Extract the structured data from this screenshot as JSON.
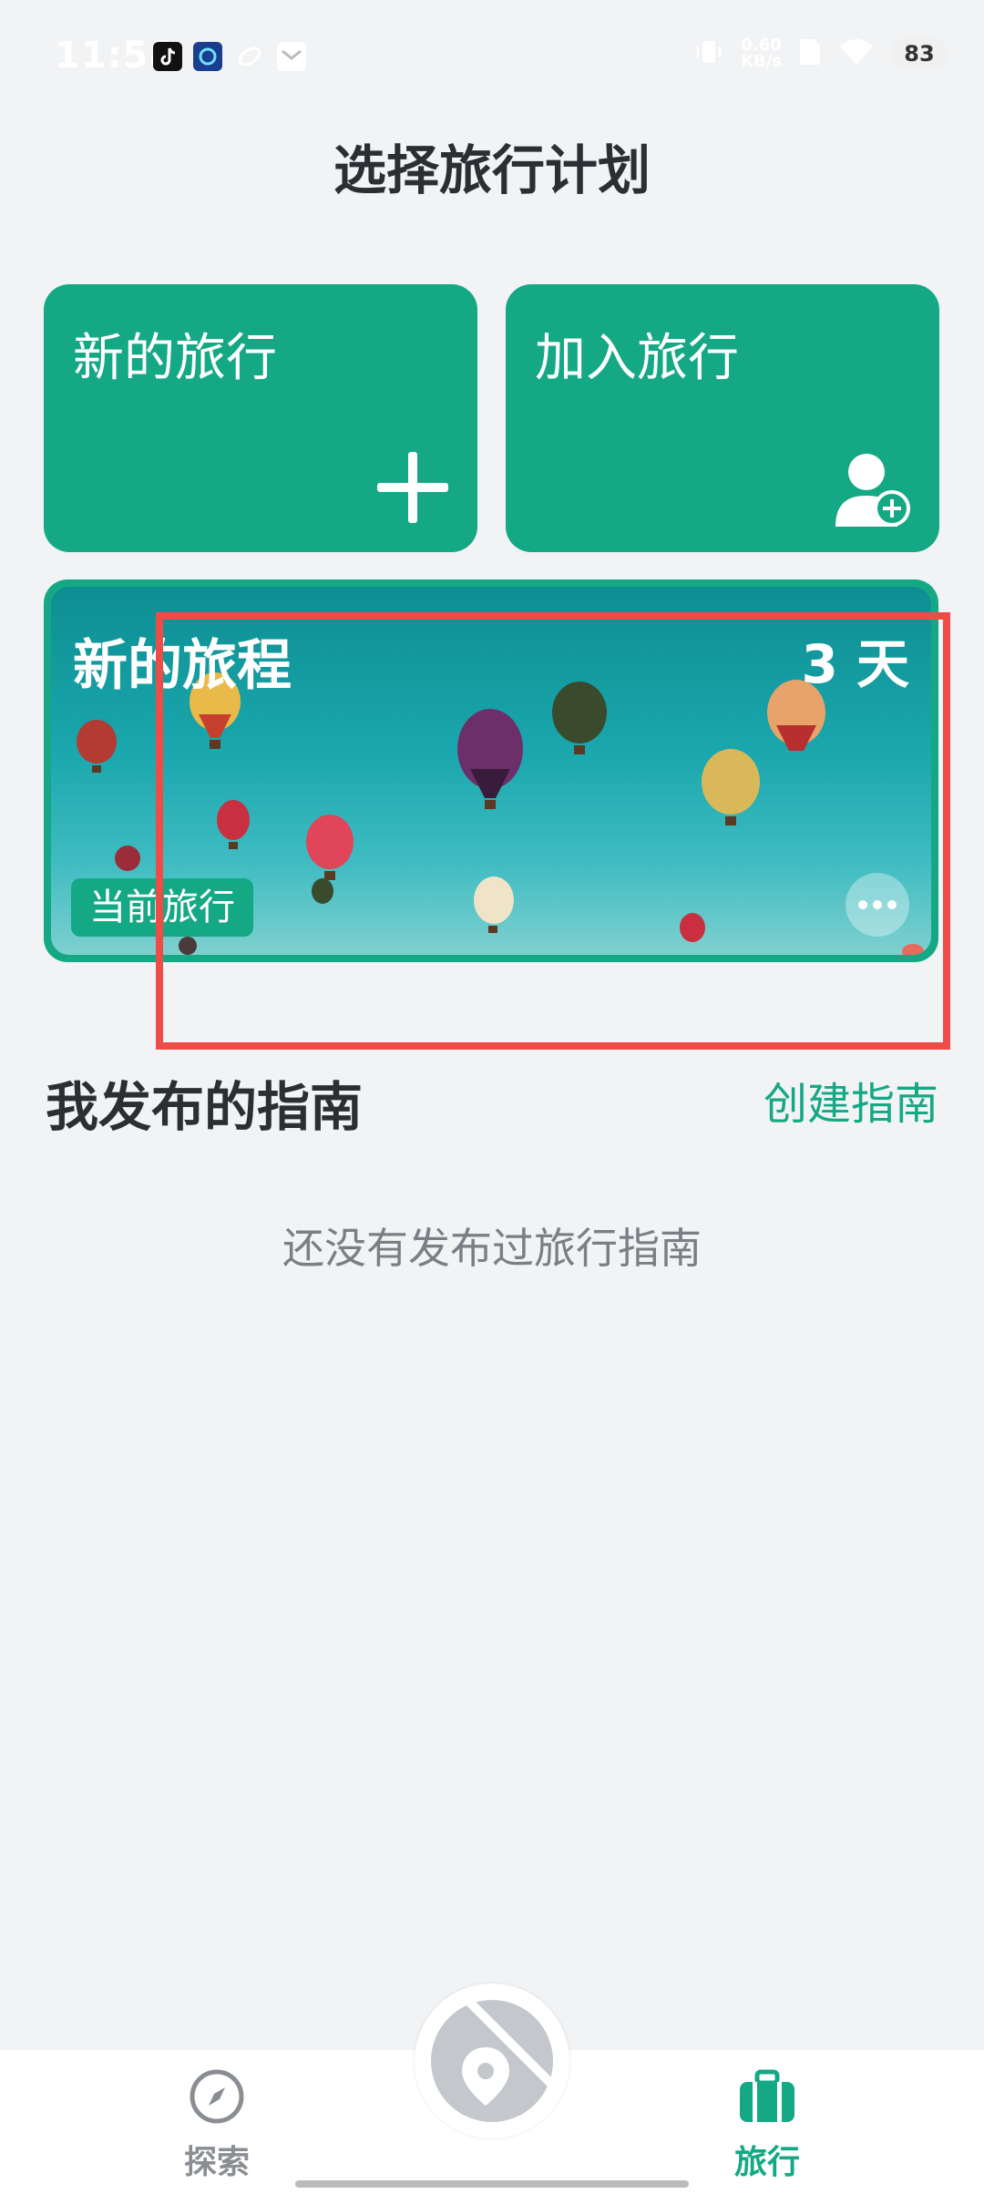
{
  "status_bar": {
    "time": "11:58",
    "net_speed_value": "0.60",
    "net_speed_unit": "KB/s",
    "battery": "83"
  },
  "header": {
    "title": "选择旅行计划"
  },
  "actions": {
    "new_trip": "新的旅行",
    "join_trip": "加入旅行"
  },
  "trip_card": {
    "name": "新的旅程",
    "days": "3 天",
    "badge": "当前旅行"
  },
  "guides": {
    "title": "我发布的指南",
    "create_label": "创建指南",
    "empty_text": "还没有发布过旅行指南"
  },
  "bottom_nav": {
    "explore_label": "探索",
    "travel_label": "旅行"
  },
  "colors": {
    "accent": "#15a885",
    "highlight": "#ee4d47",
    "background": "#f2f3f5"
  }
}
